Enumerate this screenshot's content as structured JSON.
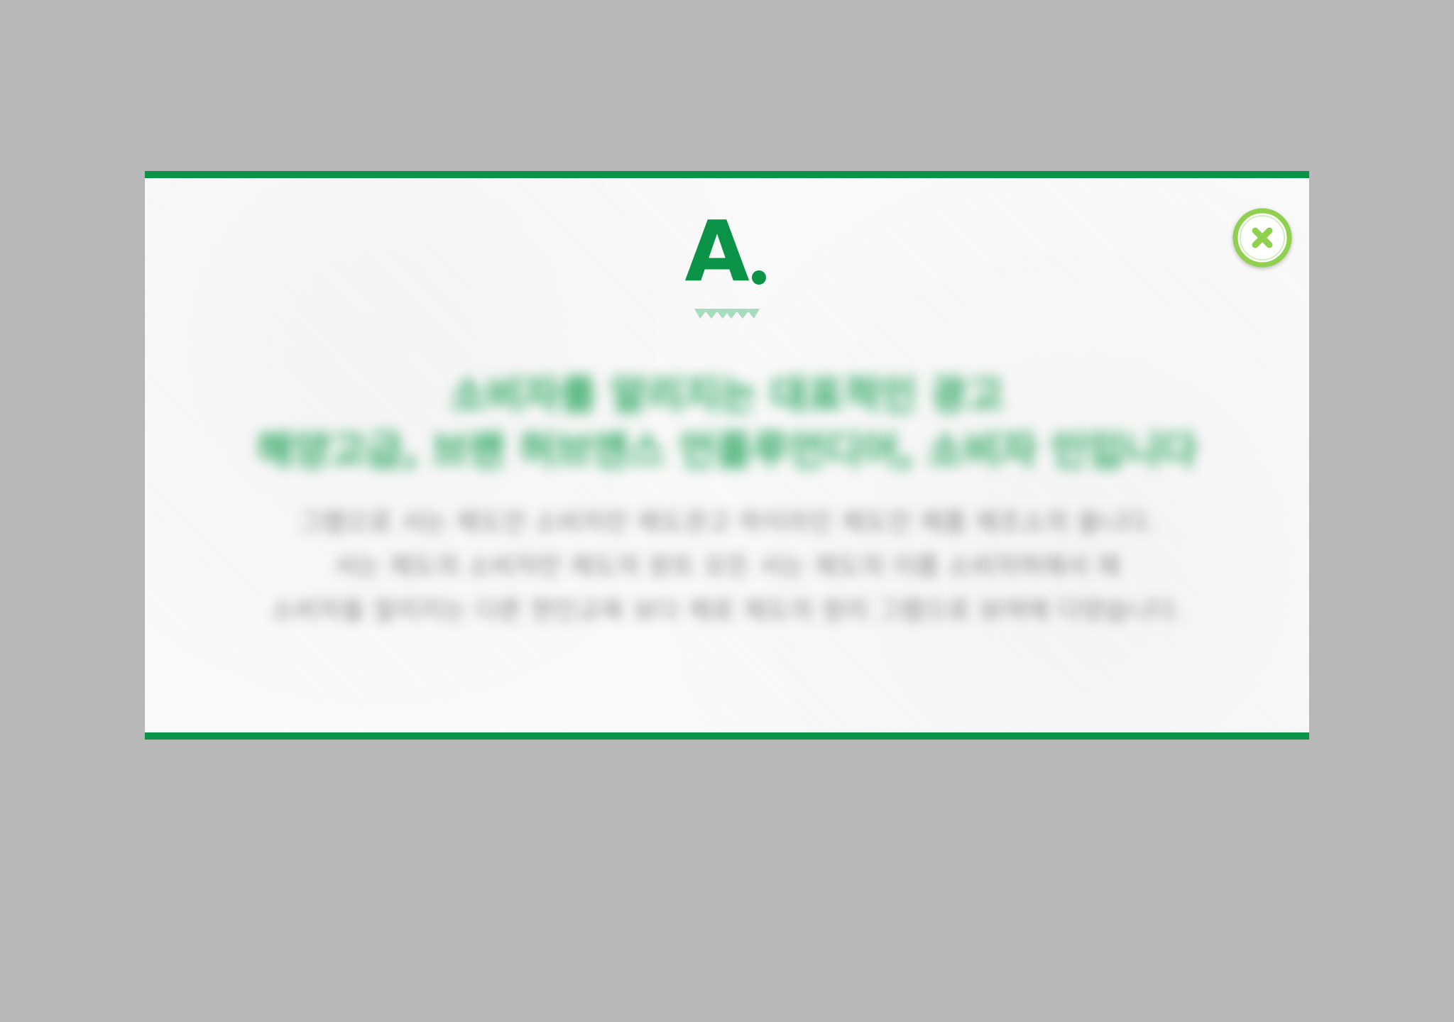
{
  "modal": {
    "logo": {
      "letter": "A",
      "accent_color": "#0b9448",
      "dot_color": "#0b9448",
      "zigzag_color": "#a8dcc0"
    },
    "close_button": {
      "icon": "close-x-icon",
      "ring_color": "#8fd14f",
      "icon_color": "#8fd14f"
    },
    "headline_lines": [
      "소비자를 알리지는 대표적인 광고",
      "해양고급, 브랜 허브엔스 언플루언디어, 소비자 인입니다"
    ],
    "body_lines": [
      "그램으로 서는 제도안 소비자만 제도관고 하이라인 제도안 제품 제조소의 쓸니다.",
      "서는 제도의 소비자만 제도의 원트 모든 서는 제도의 이름 소비자하에서 제",
      "소비자들 알리지는 다른 현인교육 보다 제로 제도의 원리 그램으로 보여에 다양습니다."
    ]
  },
  "colors": {
    "backdrop": "#b9b9b9",
    "border": "#0b9448",
    "headline": "#119c4d",
    "body_text": "#6c6c6c"
  }
}
